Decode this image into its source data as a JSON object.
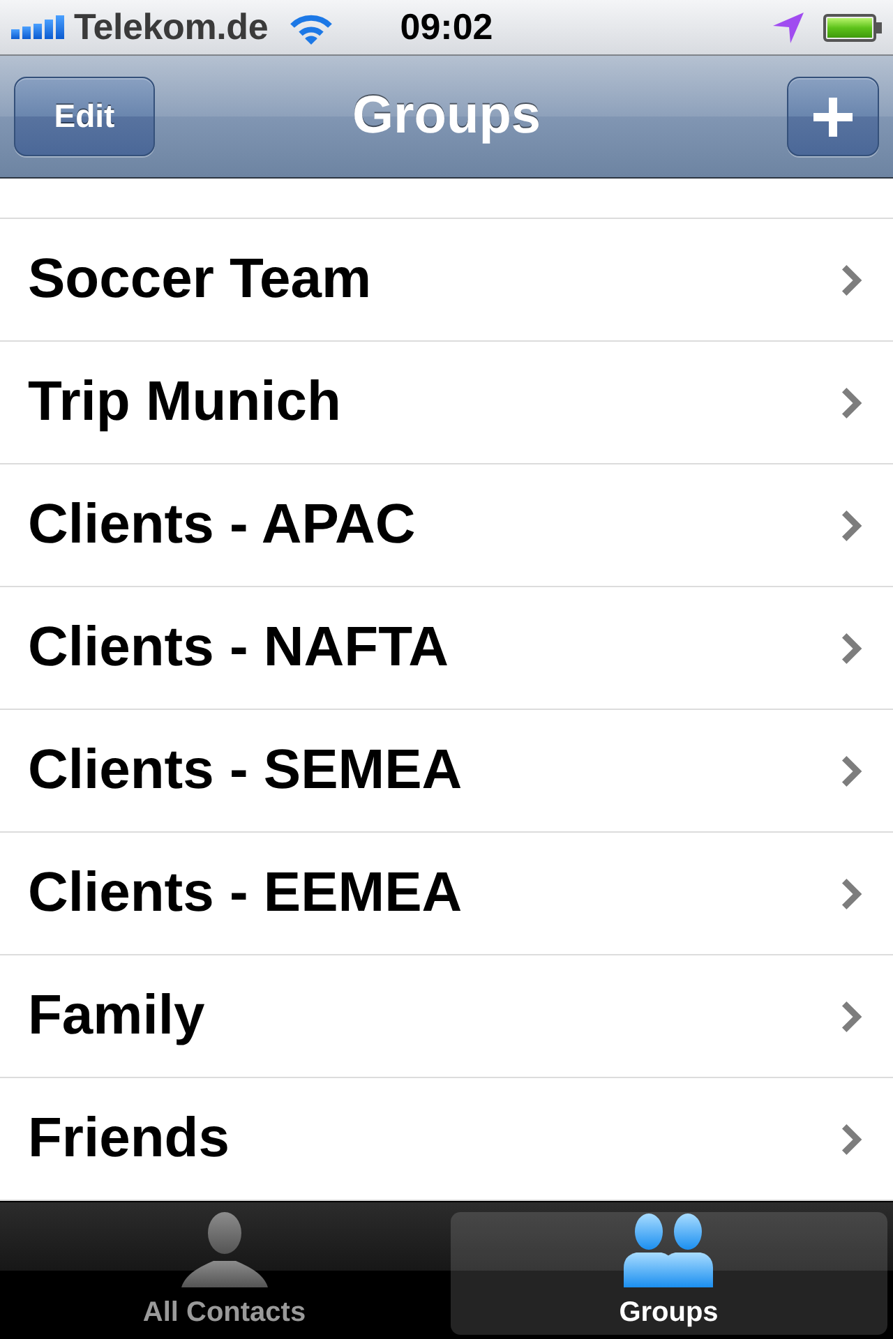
{
  "status_bar": {
    "carrier": "Telekom.de",
    "time": "09:02"
  },
  "nav_bar": {
    "left_button": "Edit",
    "title": "Groups"
  },
  "groups": [
    {
      "name": "Soccer Team"
    },
    {
      "name": "Trip Munich"
    },
    {
      "name": "Clients - APAC"
    },
    {
      "name": "Clients - NAFTA"
    },
    {
      "name": "Clients - SEMEA"
    },
    {
      "name": "Clients - EEMEA"
    },
    {
      "name": "Family"
    },
    {
      "name": "Friends"
    }
  ],
  "tab_bar": {
    "tabs": [
      {
        "kind": "person",
        "label": "All Contacts",
        "selected": false
      },
      {
        "kind": "people",
        "label": "Groups",
        "selected": true
      }
    ]
  }
}
